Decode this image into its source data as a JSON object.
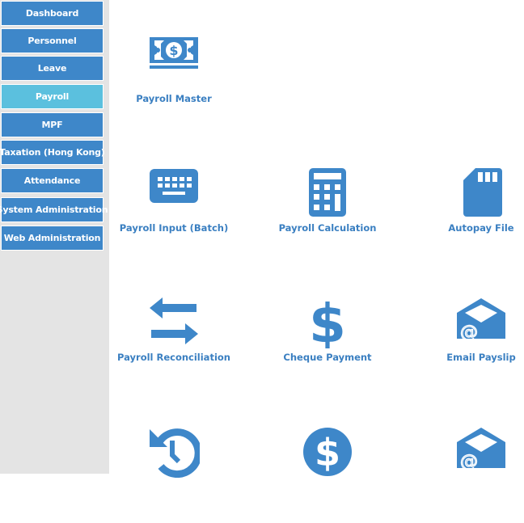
{
  "sidebar": {
    "items": [
      {
        "label": "Dashboard",
        "active": false
      },
      {
        "label": "Personnel",
        "active": false
      },
      {
        "label": "Leave",
        "active": false
      },
      {
        "label": "Payroll",
        "active": true
      },
      {
        "label": "MPF",
        "active": false
      },
      {
        "label": "Taxation (Hong Kong)",
        "active": false
      },
      {
        "label": "Attendance",
        "active": false
      },
      {
        "label": "System Administration",
        "active": false
      },
      {
        "label": "Web Administration",
        "active": false
      }
    ]
  },
  "tiles": [
    {
      "label": "Payroll Master",
      "icon": "money-bill-icon"
    },
    {
      "label": "Payroll Input (Batch)",
      "icon": "keyboard-icon"
    },
    {
      "label": "Payroll Calculation",
      "icon": "calculator-icon"
    },
    {
      "label": "Autopay File",
      "icon": "sd-card-icon"
    },
    {
      "label": "Payroll Reconciliation",
      "icon": "exchange-arrows-icon"
    },
    {
      "label": "Cheque Payment",
      "icon": "dollar-sign-icon"
    },
    {
      "label": "Email Payslip",
      "icon": "envelope-at-icon"
    },
    {
      "label": "",
      "icon": "history-clock-icon"
    },
    {
      "label": "",
      "icon": "dollar-circle-icon"
    },
    {
      "label": "",
      "icon": "envelope-at-icon"
    }
  ],
  "colors": {
    "primary": "#3e87c9",
    "active": "#5bc0de",
    "icon": "#3e87c9",
    "sidebar_bg": "#e4e4e4"
  }
}
